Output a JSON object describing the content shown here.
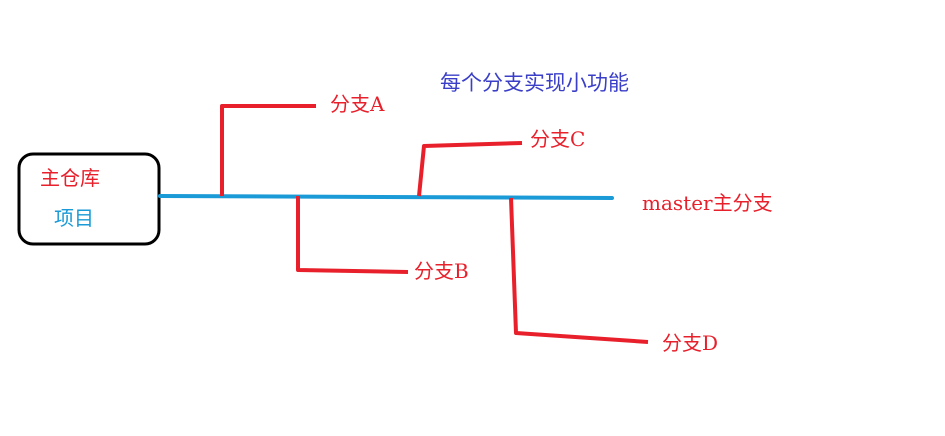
{
  "title": "每个分支实现小功能",
  "repo": {
    "line1": "主仓库",
    "line2": "项目"
  },
  "master_label": "master主分支",
  "branches": {
    "a": "分支A",
    "b": "分支B",
    "c": "分支C",
    "d": "分支D"
  },
  "colors": {
    "master_line": "#1a9ad6",
    "branch_line": "#e8202b",
    "title_text": "#3b3fc8",
    "box_border": "#000000"
  }
}
